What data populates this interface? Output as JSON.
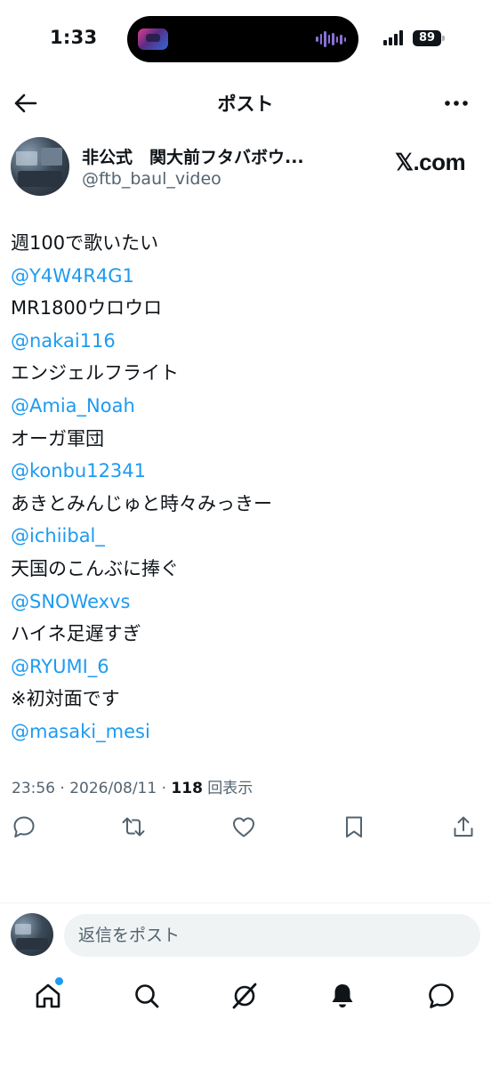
{
  "status_bar": {
    "time": "1:33",
    "battery": "89"
  },
  "header": {
    "title": "ポスト",
    "back_icon": "arrow-left-icon",
    "more_icon": "more-horizontal-icon"
  },
  "author": {
    "name": "非公式　関大前フタバボウ...",
    "handle": "@ftb_baul_video",
    "badge_text": "𝕏.com"
  },
  "post": {
    "lines": [
      {
        "text": "週100で歌いたい",
        "type": "text"
      },
      {
        "text": "@Y4W4R4G1",
        "type": "mention"
      },
      {
        "text": "MR1800ウロウロ",
        "type": "text"
      },
      {
        "text": "@nakai116",
        "type": "mention"
      },
      {
        "text": "エンジェルフライト",
        "type": "text"
      },
      {
        "text": "@Amia_Noah",
        "type": "mention"
      },
      {
        "text": "オーガ軍団",
        "type": "text"
      },
      {
        "text": "@konbu12341",
        "type": "mention"
      },
      {
        "text": "あきとみんじゅと時々みっきー",
        "type": "text"
      },
      {
        "text": "@ichiibal_",
        "type": "mention"
      },
      {
        "text": "天国のこんぶに捧ぐ",
        "type": "text"
      },
      {
        "text": "@SNOWexvs",
        "type": "mention"
      },
      {
        "text": "ハイネ足遅すぎ",
        "type": "text"
      },
      {
        "text": "@RYUMI_6",
        "type": "mention"
      },
      {
        "text": "※初対面です",
        "type": "text"
      },
      {
        "text": "@masaki_mesi",
        "type": "mention"
      }
    ],
    "timestamp": "23:56 · 2026/08/11 · ",
    "views_count": "118",
    "views_label": " 回表示"
  },
  "actions": [
    {
      "name": "reply-button",
      "icon": "reply-icon"
    },
    {
      "name": "repost-button",
      "icon": "repost-icon"
    },
    {
      "name": "like-button",
      "icon": "heart-icon"
    },
    {
      "name": "bookmark-button",
      "icon": "bookmark-icon"
    },
    {
      "name": "share-button",
      "icon": "share-icon"
    }
  ],
  "reply": {
    "placeholder": "返信をポスト"
  },
  "bottom_nav": [
    {
      "name": "nav-home",
      "icon": "home-icon"
    },
    {
      "name": "nav-search",
      "icon": "search-icon"
    },
    {
      "name": "nav-grok",
      "icon": "grok-icon"
    },
    {
      "name": "nav-notifications",
      "icon": "bell-icon"
    },
    {
      "name": "nav-messages",
      "icon": "message-icon"
    }
  ],
  "colors": {
    "link": "#1d9bf0",
    "text": "#0f1419",
    "muted": "#536471",
    "surface": "#eff3f4"
  }
}
